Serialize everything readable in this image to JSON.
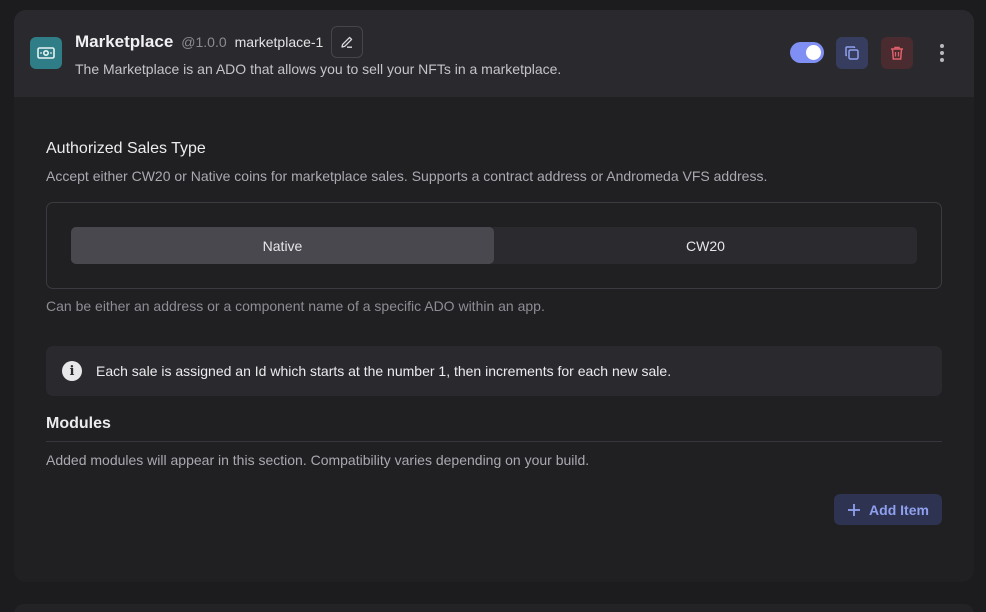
{
  "ado": {
    "title": "Marketplace",
    "version": "@1.0.0",
    "instance_name": "marketplace-1",
    "description": "The Marketplace is an ADO that allows you to sell your NFTs in a marketplace.",
    "icon": "money-icon",
    "enabled": true
  },
  "header_actions": {
    "toggle": "enable-toggle",
    "duplicate_icon": "copy-icon",
    "delete_icon": "trash-icon",
    "more_icon": "more-vertical-icon"
  },
  "sales_type": {
    "title": "Authorized Sales Type",
    "description": "Accept either CW20 or Native coins for marketplace sales. Supports a contract address or Andromeda VFS address.",
    "options": [
      "Native",
      "CW20"
    ],
    "selected": "Native",
    "hint": "Can be either an address or a component name of a specific ADO within an app."
  },
  "info": {
    "text": "Each sale is assigned an Id which starts at the number 1, then increments for each new sale."
  },
  "modules": {
    "title": "Modules",
    "description": "Added modules will appear in this section. Compatibility varies depending on your build.",
    "add_label": "Add Item"
  },
  "colors": {
    "accent": "#7f8ff4",
    "ado_icon_bg": "#2f7d86",
    "danger_bg": "#4a2b30",
    "danger_fg": "#e0606b"
  }
}
